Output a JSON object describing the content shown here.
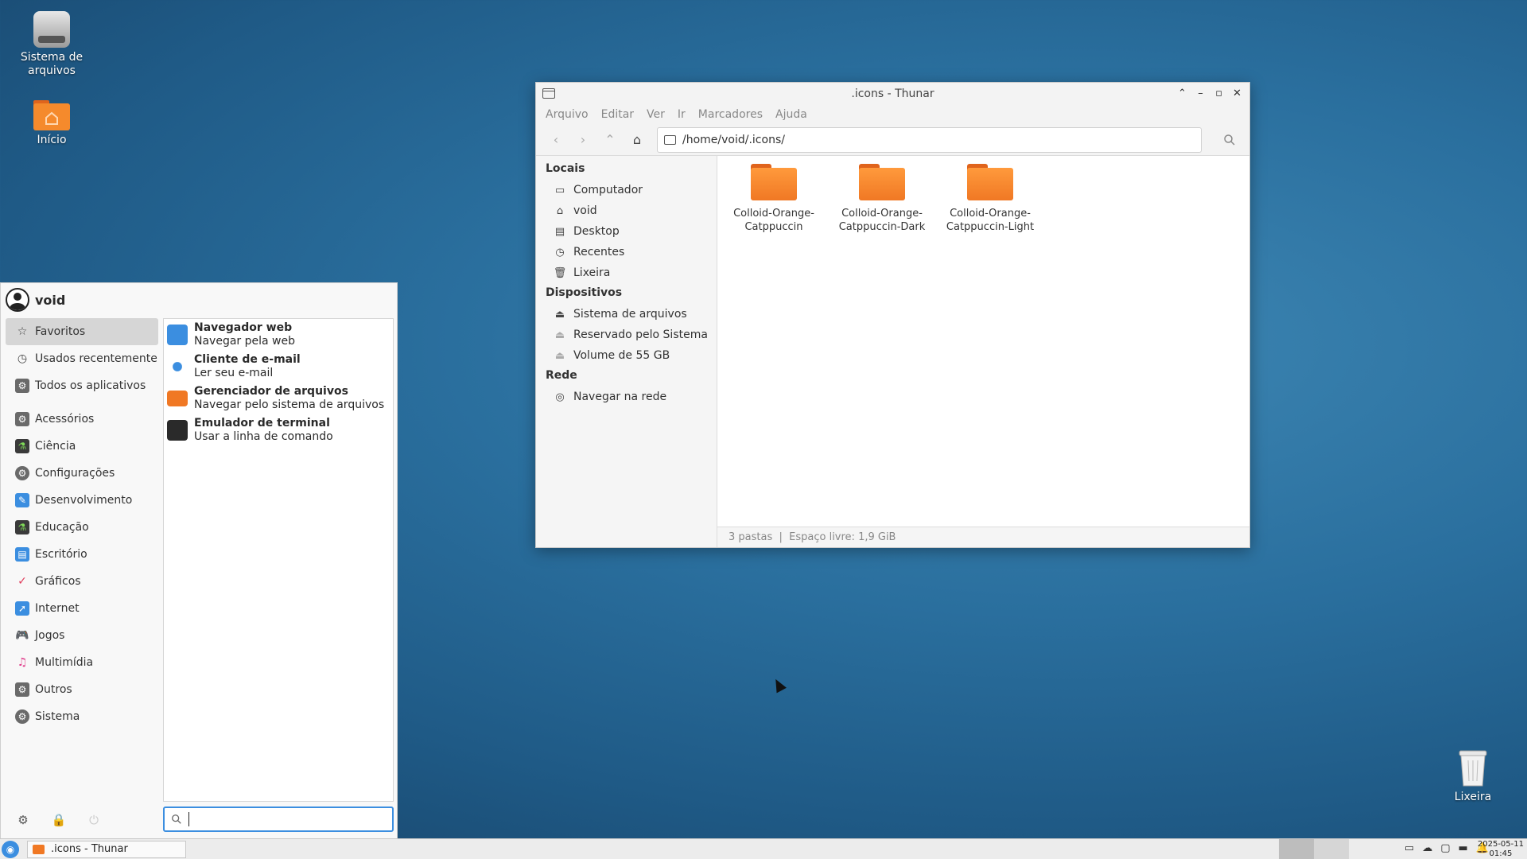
{
  "desktop": {
    "icons": [
      {
        "label": "Sistema de arquivos",
        "icon": "hard-drive-icon"
      },
      {
        "label": "Início",
        "icon": "home-folder-icon"
      },
      {
        "label": "Lixeira",
        "icon": "trash-icon"
      }
    ]
  },
  "window": {
    "title": ".icons - Thunar",
    "menu": [
      "Arquivo",
      "Editar",
      "Ver",
      "Ir",
      "Marcadores",
      "Ajuda"
    ],
    "location": "/home/void/.icons/",
    "sidebar": {
      "sections": [
        {
          "heading": "Locais",
          "items": [
            {
              "label": "Computador",
              "icon": "monitor-icon"
            },
            {
              "label": "void",
              "icon": "home-icon"
            },
            {
              "label": "Desktop",
              "icon": "desktop-icon"
            },
            {
              "label": "Recentes",
              "icon": "clock-icon"
            },
            {
              "label": "Lixeira",
              "icon": "trash-icon"
            }
          ]
        },
        {
          "heading": "Dispositivos",
          "items": [
            {
              "label": "Sistema de arquivos",
              "icon": "drive-icon"
            },
            {
              "label": "Reservado pelo Sistema",
              "icon": "drive-icon"
            },
            {
              "label": "Volume de 55 GB",
              "icon": "drive-icon"
            }
          ]
        },
        {
          "heading": "Rede",
          "items": [
            {
              "label": "Navegar na rede",
              "icon": "network-icon"
            }
          ]
        }
      ]
    },
    "files": [
      {
        "line1": "Colloid-Orange-",
        "line2": "Catppuccin"
      },
      {
        "line1": "Colloid-Orange-",
        "line2": "Catppuccin-Dark"
      },
      {
        "line1": "Colloid-Orange-",
        "line2": "Catppuccin-Light"
      }
    ],
    "status": "3 pastas  |  Espaço livre: 1,9 GiB"
  },
  "menu": {
    "user": "void",
    "categories": [
      {
        "label": "Favoritos",
        "icon": "star-icon",
        "selected": true
      },
      {
        "label": "Usados recentemente",
        "icon": "clock-icon"
      },
      {
        "label": "Todos os aplicativos",
        "icon": "apps-icon"
      },
      {
        "label": "Acessórios",
        "icon": "accessories-icon"
      },
      {
        "label": "Ciência",
        "icon": "science-icon"
      },
      {
        "label": "Configurações",
        "icon": "settings-icon"
      },
      {
        "label": "Desenvolvimento",
        "icon": "development-icon"
      },
      {
        "label": "Educação",
        "icon": "education-icon"
      },
      {
        "label": "Escritório",
        "icon": "office-icon"
      },
      {
        "label": "Gráficos",
        "icon": "graphics-icon"
      },
      {
        "label": "Internet",
        "icon": "internet-icon"
      },
      {
        "label": "Jogos",
        "icon": "games-icon"
      },
      {
        "label": "Multimídia",
        "icon": "multimedia-icon"
      },
      {
        "label": "Outros",
        "icon": "other-icon"
      },
      {
        "label": "Sistema",
        "icon": "system-icon"
      }
    ],
    "apps": [
      {
        "name": "Navegador web",
        "desc": "Navegar pela web",
        "icon": "web-browser-icon",
        "color": "#3b8ee0"
      },
      {
        "name": "Cliente de e-mail",
        "desc": "Ler seu e-mail",
        "icon": "mail-icon",
        "color": "#3b8ee0"
      },
      {
        "name": "Gerenciador de arquivos",
        "desc": "Navegar pelo sistema de arquivos",
        "icon": "file-manager-icon",
        "color": "#f07824"
      },
      {
        "name": "Emulador de terminal",
        "desc": "Usar a linha de comando",
        "icon": "terminal-icon",
        "color": "#2a2a2a"
      }
    ],
    "search_value": ""
  },
  "taskbar": {
    "task": ".icons - Thunar",
    "clock_date": "2025-05-11",
    "clock_time": "01:45"
  }
}
